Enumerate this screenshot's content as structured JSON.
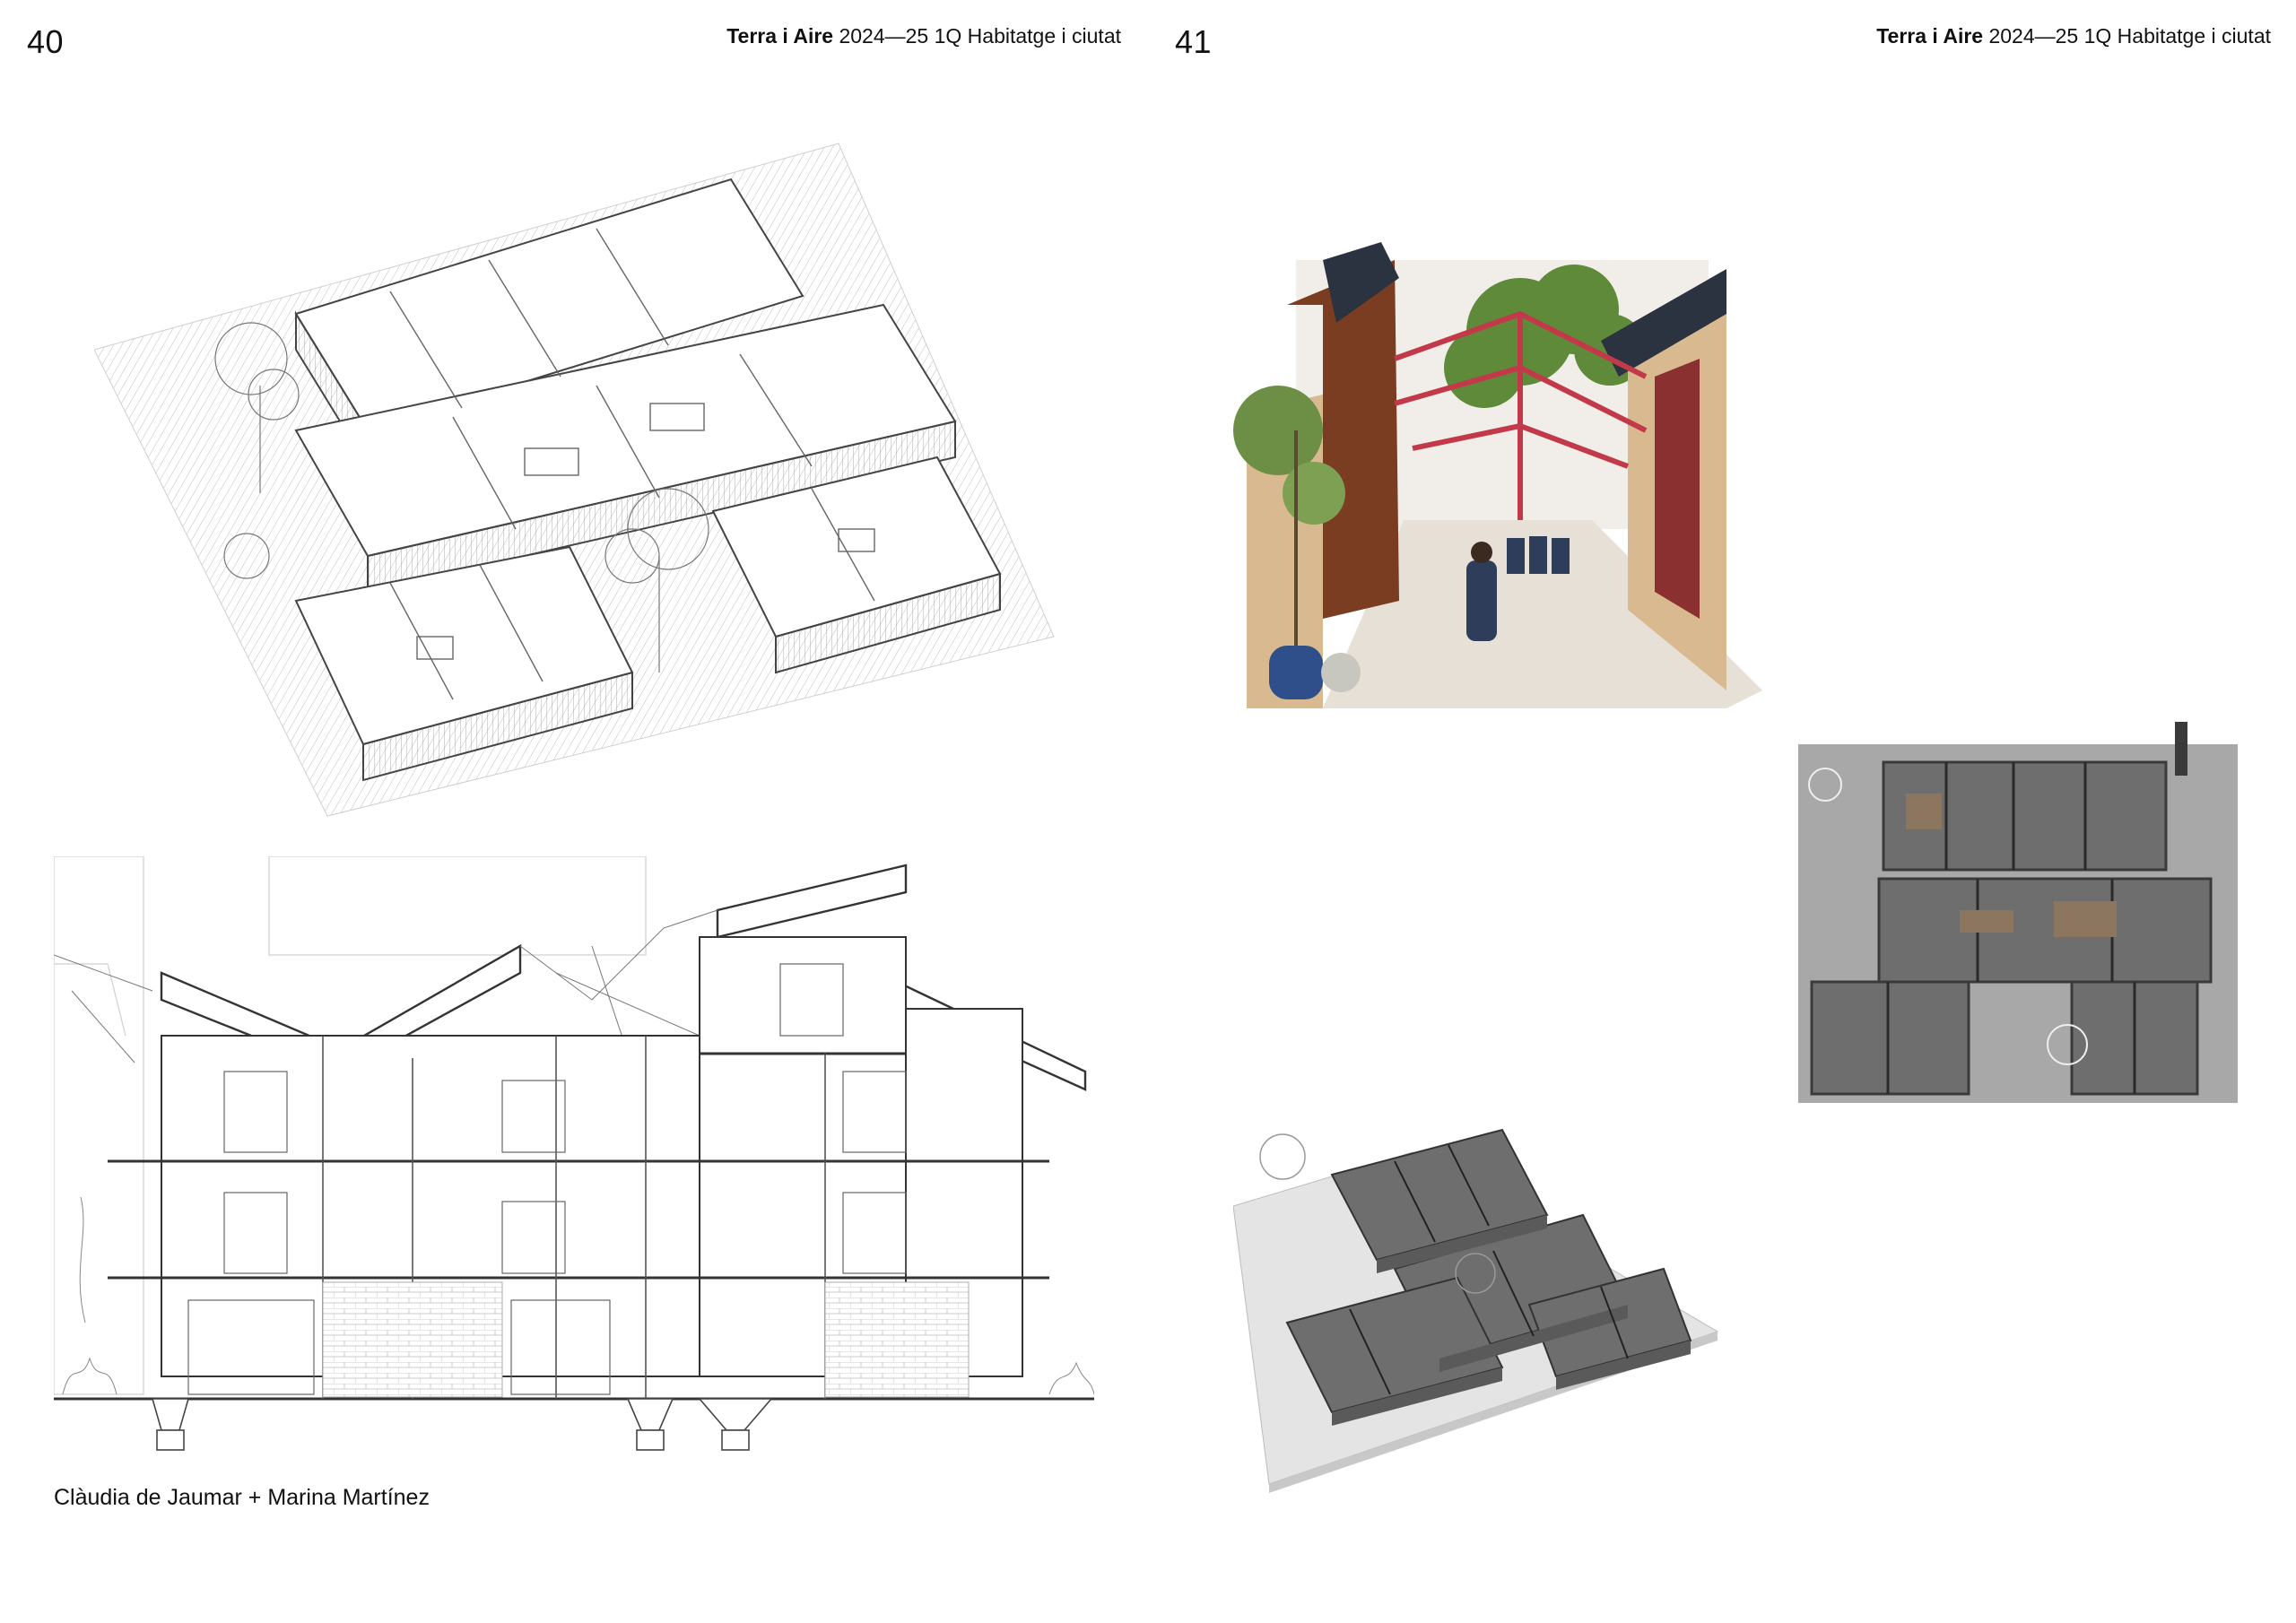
{
  "left_page": {
    "page_number": "40",
    "running_head": {
      "bold": "Terra i Aire",
      "rest": " 2024—25 1Q Habitatge i ciutat"
    },
    "credit": "Clàudia de Jaumar + Marina Martínez"
  },
  "right_page": {
    "page_number": "41",
    "running_head": {
      "bold": "Terra i Aire",
      "rest": " 2024—25 1Q Habitatge i ciutat"
    }
  },
  "colors": {
    "line_drawing": "#555555",
    "roof_truss_red": "#c23a4a",
    "timber": "#d9b98f",
    "rust": "#7a3d22",
    "model_grey": "#6e6e6e",
    "foliage": "#5f8a3a"
  }
}
